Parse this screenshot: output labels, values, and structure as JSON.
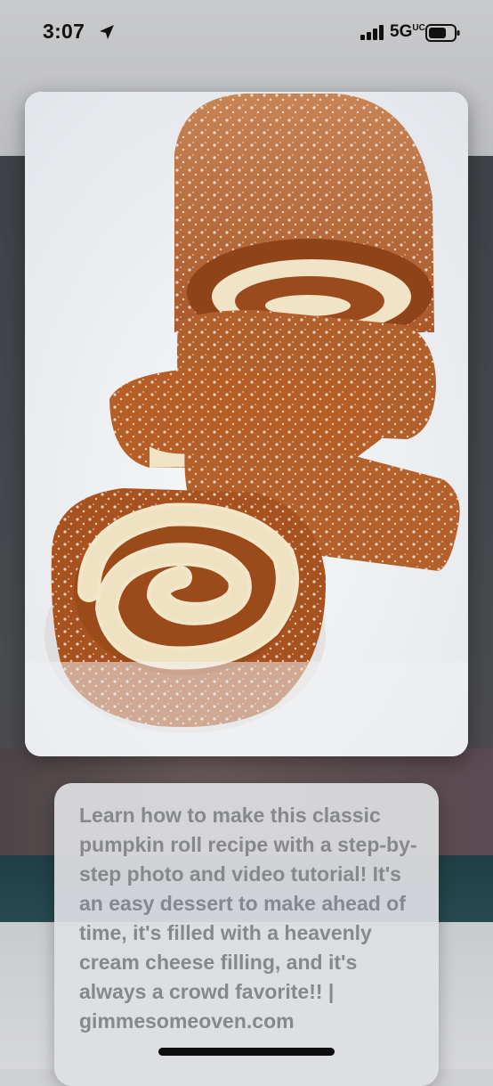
{
  "status_bar": {
    "time": "3:07",
    "network": "5G",
    "network_suffix": "UC",
    "icons": [
      "location-arrow-icon",
      "cellular-signal-icon",
      "battery-icon"
    ]
  },
  "pin": {
    "image_description_alt": "Pumpkin roll slices dusted with powdered sugar",
    "description": "Learn how to make this classic pumpkin roll recipe with a step-by-step photo and video tutorial! It's an easy dessert to make ahead of time, it's filled with a heavenly cream cheese filling, and it's always a crowd favorite!! | gimmesomeoven.com"
  },
  "colors": {
    "cake": "#b85d22",
    "cream": "#f3e8cf",
    "sugar": "#eef0f4"
  }
}
